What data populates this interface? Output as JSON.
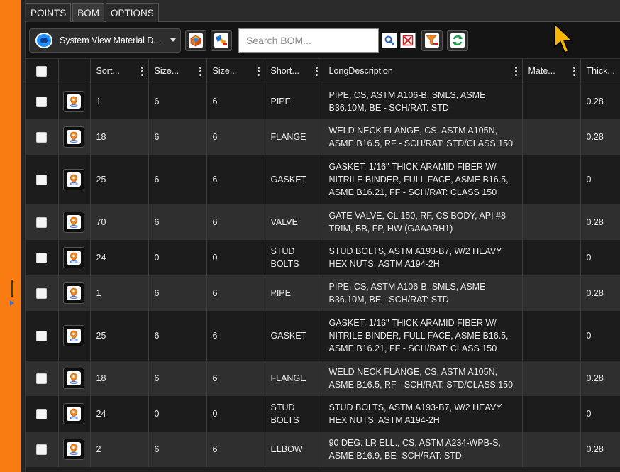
{
  "tabs": [
    {
      "label": "POINTS"
    },
    {
      "label": "BOM"
    },
    {
      "label": "OPTIONS"
    }
  ],
  "toolbar": {
    "dropdown_label": "System View Material D...",
    "search_placeholder": "Search BOM..."
  },
  "columns": [
    "Sort...",
    "Size...",
    "Size...",
    "Short...",
    "LongDescription",
    "Mate...",
    "Thick..."
  ],
  "rows": [
    {
      "sort": "1",
      "size1": "6",
      "size2": "6",
      "short": "PIPE",
      "long": "PIPE, CS, ASTM A106-B, SMLS, ASME B36.10M, BE - SCH/RAT: STD",
      "mat": "",
      "thick": "0.28"
    },
    {
      "sort": "18",
      "size1": "6",
      "size2": "6",
      "short": "FLANGE",
      "long": "WELD NECK FLANGE, CS, ASTM A105N, ASME B16.5, RF - SCH/RAT: STD/CLASS 150",
      "mat": "",
      "thick": "0.28"
    },
    {
      "sort": "25",
      "size1": "6",
      "size2": "6",
      "short": "GASKET",
      "long": "GASKET, 1/16\" THICK ARAMID FIBER W/ NITRILE BINDER, FULL FACE, ASME B16.5, ASME B16.21, FF - SCH/RAT: CLASS 150",
      "mat": "",
      "thick": "0"
    },
    {
      "sort": "70",
      "size1": "6",
      "size2": "6",
      "short": "VALVE",
      "long": "GATE VALVE, CL 150, RF, CS BODY, API #8 TRIM, BB, FP, HW (GAAARH1)",
      "mat": "",
      "thick": "0.28"
    },
    {
      "sort": "24",
      "size1": "0",
      "size2": "0",
      "short": "STUD BOLTS",
      "long": "STUD BOLTS, ASTM A193-B7, W/2 HEAVY HEX NUTS, ASTM A194-2H",
      "mat": "",
      "thick": "0"
    },
    {
      "sort": "1",
      "size1": "6",
      "size2": "6",
      "short": "PIPE",
      "long": "PIPE, CS, ASTM A106-B, SMLS, ASME B36.10M, BE - SCH/RAT: STD",
      "mat": "",
      "thick": "0.28"
    },
    {
      "sort": "25",
      "size1": "6",
      "size2": "6",
      "short": "GASKET",
      "long": "GASKET, 1/16\" THICK ARAMID FIBER W/ NITRILE BINDER, FULL FACE, ASME B16.5, ASME B16.21, FF - SCH/RAT: CLASS 150",
      "mat": "",
      "thick": "0"
    },
    {
      "sort": "18",
      "size1": "6",
      "size2": "6",
      "short": "FLANGE",
      "long": "WELD NECK FLANGE, CS, ASTM A105N, ASME B16.5, RF - SCH/RAT: STD/CLASS 150",
      "mat": "",
      "thick": "0.28"
    },
    {
      "sort": "24",
      "size1": "0",
      "size2": "0",
      "short": "STUD BOLTS",
      "long": "STUD BOLTS, ASTM A193-B7, W/2 HEAVY HEX NUTS, ASTM A194-2H",
      "mat": "",
      "thick": "0"
    },
    {
      "sort": "2",
      "size1": "6",
      "size2": "6",
      "short": "ELBOW",
      "long": "90 DEG. LR ELL., CS, ASTM A234-WPB-S, ASME B16.9, BE- SCH/RAT: STD",
      "mat": "",
      "thick": "0.28"
    }
  ],
  "colors": {
    "accent_orange": "#f97c12",
    "row_dark": "#1c1c1c",
    "row_light": "#2f2f2f",
    "cursor_yellow": "#f7b500"
  },
  "icons": [
    "system-view-logo-icon",
    "package-icon",
    "pipe-remove-icon",
    "search-icon",
    "clear-icon",
    "filter-remove-icon",
    "refresh-icon",
    "location-pin-icon",
    "mouse-cursor-icon"
  ]
}
